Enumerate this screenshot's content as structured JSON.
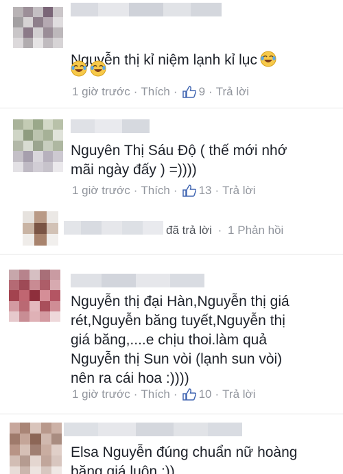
{
  "comments": [
    {
      "text": "Nguyễn thị kỉ niệm lạnh kỉ lục",
      "emoji": [
        "laughing-tears-emoji",
        "laughing-tears-emoji",
        "laughing-tears-emoji"
      ],
      "time": "1 giờ trước",
      "like_label": "Thích",
      "likes": "9",
      "reply_label": "Trả lời"
    },
    {
      "text": "Nguyên Thị Sáu Độ ( thế mới nhớ\nmãi ngày đấy ) =))))",
      "time": "1 giờ trước",
      "like_label": "Thích",
      "likes": "13",
      "reply_label": "Trả lời"
    },
    {
      "text": "Nguyễn thị đại Hàn,Nguyễn thị giá\nrét,Nguyễn băng tuyết,Nguyễn thị\ngiá băng,....e chịu thoi.làm quả\nNguyễn thị Sun vòi (lạnh sun vòi)\nnên ra cái hoa :))))",
      "time": "1 giờ trước",
      "like_label": "Thích",
      "likes": "10",
      "reply_label": "Trả lời"
    },
    {
      "text": "Elsa Nguyễn đúng chuẩn nữ hoàng\nbăng giá luôn :))"
    }
  ],
  "reply_summary": {
    "action": "đã trả lời",
    "separator": "·",
    "count_label": "1 Phản hồi"
  },
  "meta_separator": "·",
  "colors": {
    "meta": "#90949c",
    "text": "#1d2129",
    "like_icon": "#4267b2",
    "divider": "#e5e5e5"
  }
}
